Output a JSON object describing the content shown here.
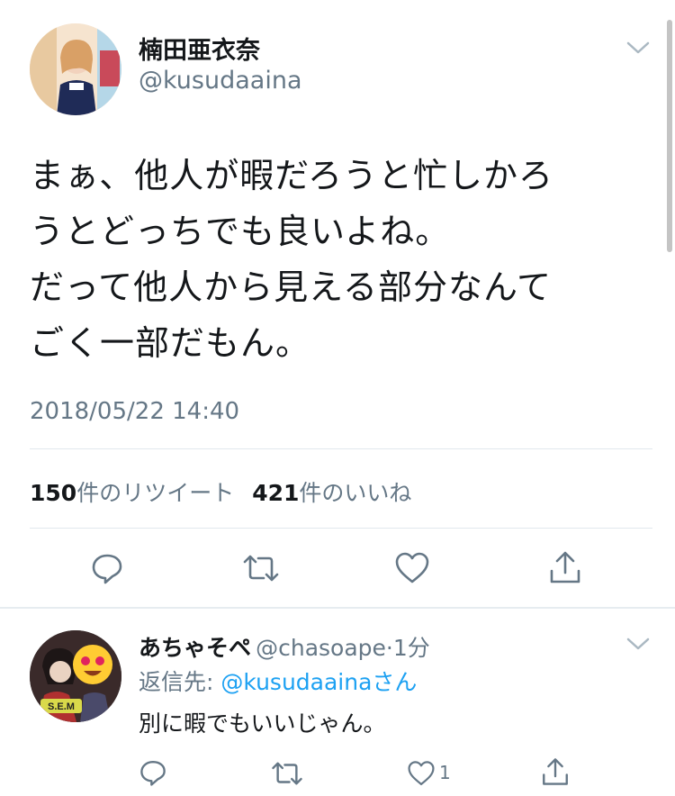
{
  "tweet": {
    "display_name": "楠田亜衣奈",
    "handle": "@kusudaaina",
    "text_lines": [
      "まぁ、他人が暇だろうと忙しかろ",
      "うとどっちでも良いよね。",
      "だって他人から見える部分なんて",
      "ごく一部だもん。"
    ],
    "timestamp": "2018/05/22 14:40",
    "retweet_count": "150",
    "retweet_label": "件のリツイート",
    "like_count": "421",
    "like_label": "件のいいね",
    "actions": [
      "reply-icon",
      "retweet-icon",
      "like-icon",
      "share-icon"
    ]
  },
  "reply": {
    "display_name": "あちゃそペ",
    "handle": "@chasoape",
    "separator": "·",
    "time_ago": "1分",
    "reply_to_prefix": "返信先: ",
    "reply_to_handle": "@kusudaaina",
    "reply_to_suffix": "さん",
    "text": "別に暇でもいいじゃん。",
    "like_count": "1",
    "avatar_badge": "S.E.M"
  },
  "colors": {
    "link": "#1da1f2",
    "secondary": "#657786",
    "primary": "#14171a",
    "divider": "#e1e8ed"
  }
}
